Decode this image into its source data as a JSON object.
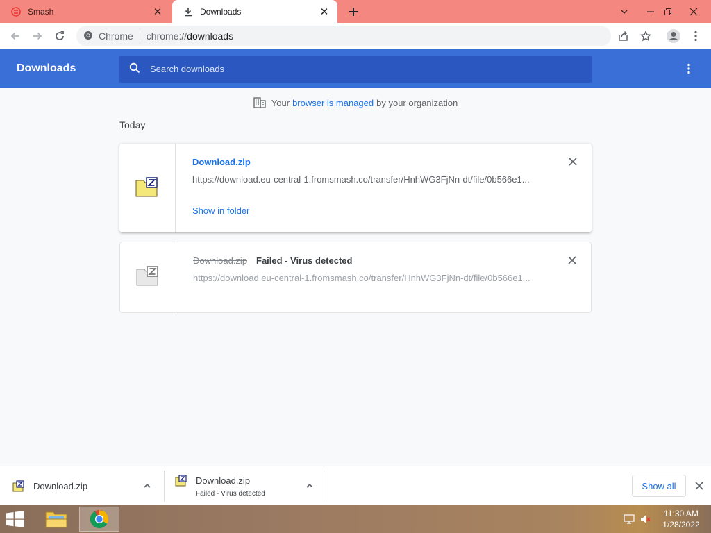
{
  "tabs": [
    {
      "title": "Smash",
      "active": false
    },
    {
      "title": "Downloads",
      "active": true
    }
  ],
  "toolbar": {
    "site_label": "Chrome",
    "url_prefix": "chrome://",
    "url_host": "downloads"
  },
  "header": {
    "title": "Downloads",
    "search_placeholder": "Search downloads"
  },
  "managed_notice": {
    "before": "Your",
    "link": "browser is managed",
    "after": "by your organization"
  },
  "section_date": "Today",
  "downloads": [
    {
      "file_name": "Download.zip",
      "url": "https://download.eu-central-1.fromsmash.co/transfer/HnhWG3FjNn-dt/file/0b566e1...",
      "action": "Show in folder",
      "status": ""
    },
    {
      "file_name": "Download.zip",
      "url": "https://download.eu-central-1.fromsmash.co/transfer/HnhWG3FjNn-dt/file/0b566e1...",
      "status": "Failed - Virus detected"
    }
  ],
  "shelf": {
    "items": [
      {
        "name": "Download.zip",
        "sub": ""
      },
      {
        "name": "Download.zip",
        "sub": "Failed - Virus detected"
      }
    ],
    "show_all": "Show all"
  },
  "clock": {
    "time": "11:30 AM",
    "date": "1/28/2022"
  },
  "colors": {
    "tab_strip": "#f48880",
    "header_blue": "#3a6fd8",
    "link_blue": "#1a73e8"
  }
}
